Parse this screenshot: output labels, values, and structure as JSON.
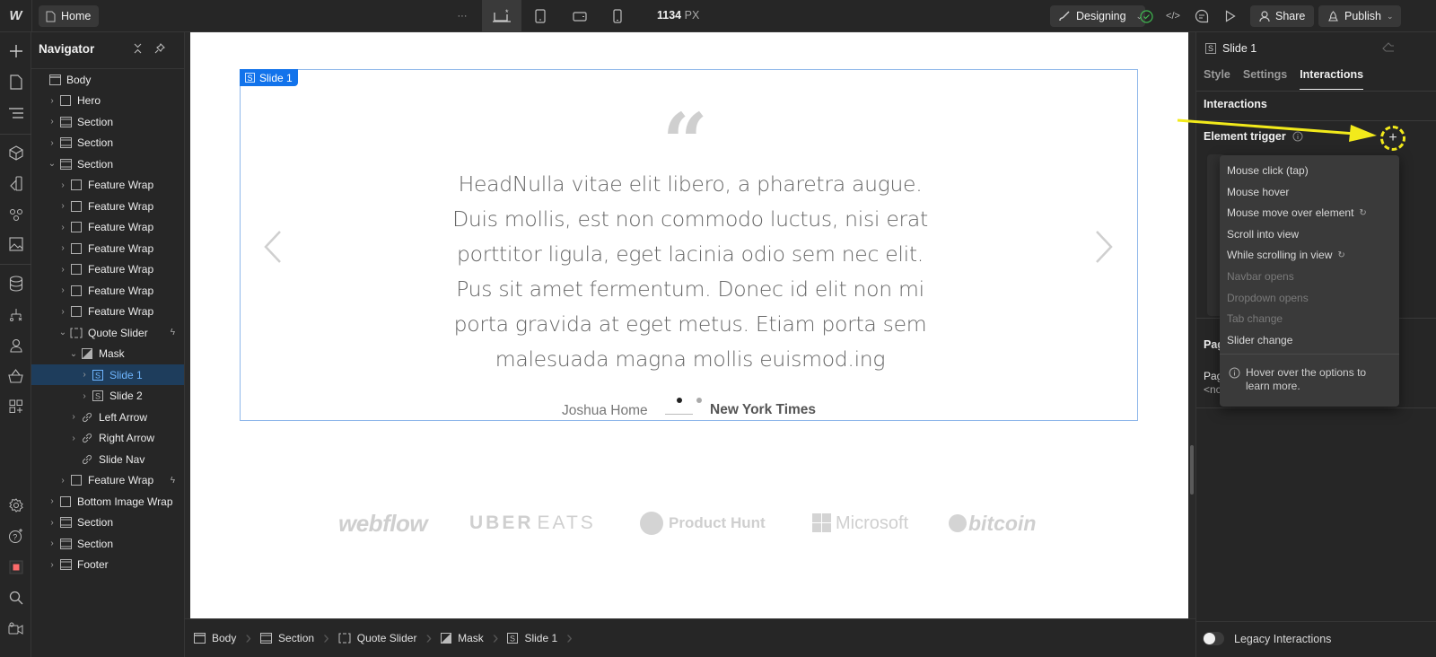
{
  "topbar": {
    "logo": "W",
    "page_button": "Home",
    "more_label": "···",
    "breakpoints": [
      {
        "name": "desktop-base",
        "icon": "desktop-star-icon",
        "active": true
      },
      {
        "name": "tablet",
        "icon": "tablet-icon",
        "active": false
      },
      {
        "name": "mobile-landscape",
        "icon": "mobile-landscape-icon",
        "active": false
      },
      {
        "name": "mobile-portrait",
        "icon": "mobile-portrait-icon",
        "active": false
      }
    ],
    "width_value": "1134",
    "width_unit": "PX",
    "mode_label": "Designing",
    "share_label": "Share",
    "publish_label": "Publish",
    "status_color": "#3fb950"
  },
  "navigator": {
    "title": "Navigator",
    "items": [
      {
        "label": "Body",
        "depth": 0,
        "icon": "body",
        "chev": ""
      },
      {
        "label": "Hero",
        "depth": 1,
        "icon": "box",
        "chev": ">"
      },
      {
        "label": "Section",
        "depth": 1,
        "icon": "section",
        "chev": ">"
      },
      {
        "label": "Section",
        "depth": 1,
        "icon": "section",
        "chev": ">"
      },
      {
        "label": "Section",
        "depth": 1,
        "icon": "section",
        "chev": "v"
      },
      {
        "label": "Feature Wrap",
        "depth": 2,
        "icon": "box",
        "chev": ">"
      },
      {
        "label": "Feature Wrap",
        "depth": 2,
        "icon": "box",
        "chev": ">"
      },
      {
        "label": "Feature Wrap",
        "depth": 2,
        "icon": "box",
        "chev": ">"
      },
      {
        "label": "Feature Wrap",
        "depth": 2,
        "icon": "box",
        "chev": ">"
      },
      {
        "label": "Feature Wrap",
        "depth": 2,
        "icon": "box",
        "chev": ">"
      },
      {
        "label": "Feature Wrap",
        "depth": 2,
        "icon": "box",
        "chev": ">"
      },
      {
        "label": "Feature Wrap",
        "depth": 2,
        "icon": "box",
        "chev": ">"
      },
      {
        "label": "Quote Slider",
        "depth": 2,
        "icon": "slider",
        "chev": "v",
        "bolt": true
      },
      {
        "label": "Mask",
        "depth": 3,
        "icon": "mask",
        "chev": "v"
      },
      {
        "label": "Slide 1",
        "depth": 4,
        "icon": "slide",
        "chev": ">",
        "selected": true
      },
      {
        "label": "Slide 2",
        "depth": 4,
        "icon": "slide",
        "chev": ">"
      },
      {
        "label": "Left Arrow",
        "depth": 3,
        "icon": "link",
        "chev": ">"
      },
      {
        "label": "Right Arrow",
        "depth": 3,
        "icon": "link",
        "chev": ">"
      },
      {
        "label": "Slide Nav",
        "depth": 3,
        "icon": "link",
        "chev": ""
      },
      {
        "label": "Feature Wrap",
        "depth": 2,
        "icon": "box",
        "chev": ">",
        "bolt": true
      },
      {
        "label": "Bottom Image Wrap",
        "depth": 1,
        "icon": "box",
        "chev": ">"
      },
      {
        "label": "Section",
        "depth": 1,
        "icon": "section",
        "chev": ">"
      },
      {
        "label": "Section",
        "depth": 1,
        "icon": "section",
        "chev": ">"
      },
      {
        "label": "Footer",
        "depth": 1,
        "icon": "section",
        "chev": ">"
      }
    ]
  },
  "canvas": {
    "selected_tag": "Slide 1",
    "quote_mark": "“",
    "quote": "HeadNulla vitae elit libero, a pharetra augue. Duis mollis, est non commodo luctus, nisi erat porttitor ligula, eget lacinia odio sem nec elit. Pus sit amet fermentum. Donec id elit non mi porta gravida at eget metus. Etiam porta sem malesuada magna mollis euismod.ing",
    "author": "Joshua Home",
    "publication": "New York Times",
    "slide_count": 2,
    "active_slide": 1,
    "logos": [
      "webflow",
      "UBER",
      "EATS",
      "Product Hunt",
      "Microsoft",
      "bitcoin"
    ],
    "accent": "#1273eb"
  },
  "breadcrumbs": [
    {
      "label": "Body",
      "icon": "body-icon"
    },
    {
      "label": "Section",
      "icon": "section-icon"
    },
    {
      "label": "Quote Slider",
      "icon": "slider-icon"
    },
    {
      "label": "Mask",
      "icon": "mask-icon"
    },
    {
      "label": "Slide 1",
      "icon": "slide-icon"
    }
  ],
  "panel": {
    "element_name": "Slide 1",
    "tabs": [
      "Style",
      "Settings",
      "Interactions"
    ],
    "active_tab": "Interactions",
    "section_title": "Interactions",
    "element_trigger_label": "Element trigger",
    "page_trigger_label": "Pag",
    "page_sub_label": "Pag",
    "page_sub_value": "<nc",
    "hidden_fragment": "i",
    "trigger_menu": [
      {
        "label": "Mouse click (tap)",
        "enabled": true,
        "badge": false
      },
      {
        "label": "Mouse hover",
        "enabled": true,
        "badge": false
      },
      {
        "label": "Mouse move over element",
        "enabled": true,
        "badge": true
      },
      {
        "label": "Scroll into view",
        "enabled": true,
        "badge": false
      },
      {
        "label": "While scrolling in view",
        "enabled": true,
        "badge": true
      },
      {
        "label": "Navbar opens",
        "enabled": false,
        "badge": false
      },
      {
        "label": "Dropdown opens",
        "enabled": false,
        "badge": false
      },
      {
        "label": "Tab change",
        "enabled": false,
        "badge": false
      },
      {
        "label": "Slider change",
        "enabled": true,
        "badge": false
      }
    ],
    "menu_hint": "Hover over the options to learn more.",
    "legacy_label": "Legacy Interactions",
    "legacy_enabled": false,
    "annotation_color": "#f2ea1b"
  }
}
